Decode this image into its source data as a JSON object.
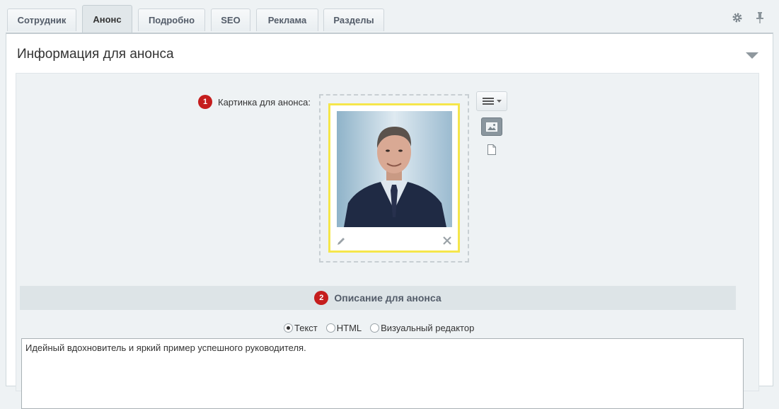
{
  "tabs": [
    {
      "label": "Сотрудник"
    },
    {
      "label": "Анонс"
    },
    {
      "label": "Подробно"
    },
    {
      "label": "SEO"
    },
    {
      "label": "Реклама"
    },
    {
      "label": "Разделы"
    }
  ],
  "active_tab": "Анонс",
  "tools": {
    "settings_icon": "gear-icon",
    "pin_icon": "pin-icon"
  },
  "section": {
    "title": "Информация для анонса"
  },
  "preview_image": {
    "badge": "1",
    "label": "Картинка для анонса:",
    "image_alt": "Фото сотрудника"
  },
  "description": {
    "badge": "2",
    "title": "Описание для анонса",
    "modes": [
      "Текст",
      "HTML",
      "Визуальный редактор"
    ],
    "selected_mode": "Текст",
    "text": "Идейный вдохновитель и яркий пример успешного руководителя."
  },
  "colors": {
    "badge": "#c51d1d",
    "frame": "#f5e64b",
    "panel_bg": "#eef2f4"
  }
}
